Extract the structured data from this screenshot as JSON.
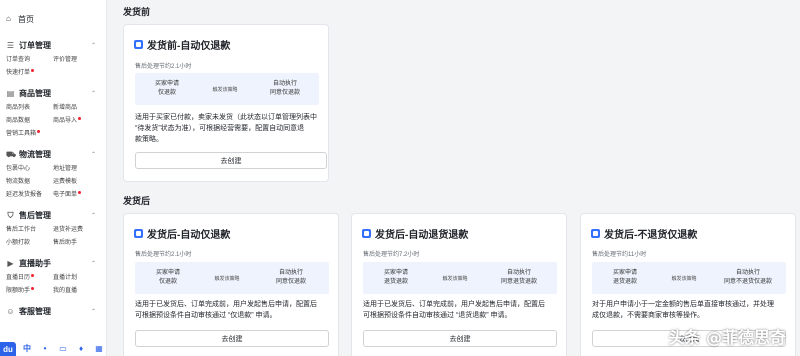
{
  "sidebar": {
    "home_label": "首页",
    "sections": [
      {
        "label": "订单管理",
        "items": [
          {
            "label": "订单查询",
            "dot": false
          },
          {
            "label": "评价管理",
            "dot": false
          },
          {
            "label": "快速打单",
            "dot": true
          }
        ]
      },
      {
        "label": "商品管理",
        "items": [
          {
            "label": "商品列表",
            "dot": false
          },
          {
            "label": "新增商品",
            "dot": false
          },
          {
            "label": "商品数据",
            "dot": false
          },
          {
            "label": "商品导入",
            "dot": true
          },
          {
            "label": "营销工具箱",
            "dot": true
          }
        ]
      },
      {
        "label": "物流管理",
        "items": [
          {
            "label": "包裹中心",
            "dot": false
          },
          {
            "label": "地址管理",
            "dot": false
          },
          {
            "label": "物流数据",
            "dot": false
          },
          {
            "label": "运费模板",
            "dot": false
          },
          {
            "label": "延迟发货报备",
            "dot": false
          },
          {
            "label": "电子面单",
            "dot": true
          }
        ]
      },
      {
        "label": "售后管理",
        "items": [
          {
            "label": "售后工作台",
            "dot": false
          },
          {
            "label": "退货补运费",
            "dot": false
          },
          {
            "label": "小额打款",
            "dot": false
          },
          {
            "label": "售后助手",
            "dot": false
          }
        ]
      },
      {
        "label": "直播助手",
        "items": [
          {
            "label": "直播日历",
            "dot": true
          },
          {
            "label": "直播计划",
            "dot": false
          },
          {
            "label": "限额助手",
            "dot": true
          },
          {
            "label": "我的直播",
            "dot": false
          }
        ]
      },
      {
        "label": "客服管理",
        "items": []
      }
    ],
    "bottom": {
      "logo": "du",
      "lang": "中"
    }
  },
  "before": {
    "group_title": "发货前",
    "card": {
      "title": "发货前-自动仅退款",
      "subtitle": "售后处理节约2.1小时",
      "flow": {
        "step1": [
          "买家申请",
          "仅退款"
        ],
        "mid": "触发该策略",
        "step2": [
          "自动执行",
          "同意仅退款"
        ]
      },
      "desc": [
        "适用于买家已付款，卖家未发货（此状态以订单管理列表中",
        "“待发货”状态为准），可根据经营需要，配置自动同意退",
        "款策略。"
      ],
      "button": "去创建"
    }
  },
  "after": {
    "group_title": "发货后",
    "cards": [
      {
        "title": "发货后-自动仅退款",
        "subtitle": "售后处理节约2.1小时",
        "flow": {
          "step1": [
            "买家申请",
            "仅退款"
          ],
          "mid": "触发该策略",
          "step2": [
            "自动执行",
            "同意仅退款"
          ]
        },
        "desc": [
          "适用于已发货后、订单完成前，用户发起售后申请，配置后",
          "可根据预设条件自动审核通过 “仅退款” 申请。"
        ],
        "button": "去创建"
      },
      {
        "title": "发货后-自动退货退款",
        "subtitle": "售后处理节约7.2小时",
        "flow": {
          "step1": [
            "买家申请",
            "退货退款"
          ],
          "mid": "触发该策略",
          "step2": [
            "自动执行",
            "同意退货退款"
          ]
        },
        "desc": [
          "适用于已发货后、订单完成前，用户发起售后申请，配置后",
          "可根据预设条件自动审核通过 “退货退款” 申请。"
        ],
        "button": "去创建"
      },
      {
        "title": "发货后-不退货仅退款",
        "subtitle": "售后处理节约11小时",
        "flow": {
          "step1": [
            "买家申请",
            "退货退款"
          ],
          "mid": "触发该策略",
          "step2": [
            "自动执行",
            "同意不退货仅退款"
          ]
        },
        "desc": [
          "对于用户申请小于一定金额的售后单直接审核通过，并处理",
          "成仅退款，不需要商家审核等操作。"
        ],
        "button": "去创建"
      }
    ]
  },
  "watermark": "头条 @菲德思奇"
}
